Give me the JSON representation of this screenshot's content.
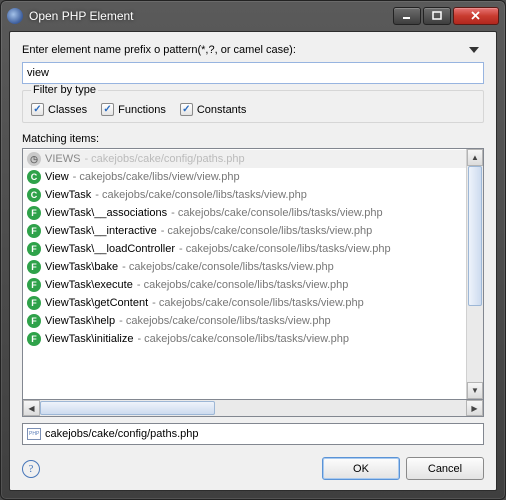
{
  "window": {
    "title": "Open PHP Element"
  },
  "prompt": "Enter element name prefix o pattern(*,?, or camel case):",
  "search": {
    "value": "view"
  },
  "filter": {
    "legend": "Filter by type",
    "classes": "Classes",
    "functions": "Functions",
    "constants": "Constants"
  },
  "matching_label": "Matching items:",
  "items": [
    {
      "kind": "hist",
      "badge": "◷",
      "name": "VIEWS",
      "path": " - cakejobs/cake/config/paths.php",
      "selected": true,
      "dim": true
    },
    {
      "kind": "C",
      "badge": "C",
      "name": "View",
      "path": " - cakejobs/cake/libs/view/view.php"
    },
    {
      "kind": "C",
      "badge": "C",
      "name": "ViewTask",
      "path": " - cakejobs/cake/console/libs/tasks/view.php"
    },
    {
      "kind": "F",
      "badge": "F",
      "name": "ViewTask\\__associations",
      "path": " - cakejobs/cake/console/libs/tasks/view.php"
    },
    {
      "kind": "F",
      "badge": "F",
      "name": "ViewTask\\__interactive",
      "path": " - cakejobs/cake/console/libs/tasks/view.php"
    },
    {
      "kind": "F",
      "badge": "F",
      "name": "ViewTask\\__loadController",
      "path": " - cakejobs/cake/console/libs/tasks/view.php"
    },
    {
      "kind": "F",
      "badge": "F",
      "name": "ViewTask\\bake",
      "path": " - cakejobs/cake/console/libs/tasks/view.php"
    },
    {
      "kind": "F",
      "badge": "F",
      "name": "ViewTask\\execute",
      "path": " - cakejobs/cake/console/libs/tasks/view.php"
    },
    {
      "kind": "F",
      "badge": "F",
      "name": "ViewTask\\getContent",
      "path": " - cakejobs/cake/console/libs/tasks/view.php"
    },
    {
      "kind": "F",
      "badge": "F",
      "name": "ViewTask\\help",
      "path": " - cakejobs/cake/console/libs/tasks/view.php"
    },
    {
      "kind": "F",
      "badge": "F",
      "name": "ViewTask\\initialize",
      "path": " - cakejobs/cake/console/libs/tasks/view.php"
    }
  ],
  "status_path": "cakejobs/cake/config/paths.php",
  "buttons": {
    "ok": "OK",
    "cancel": "Cancel"
  }
}
